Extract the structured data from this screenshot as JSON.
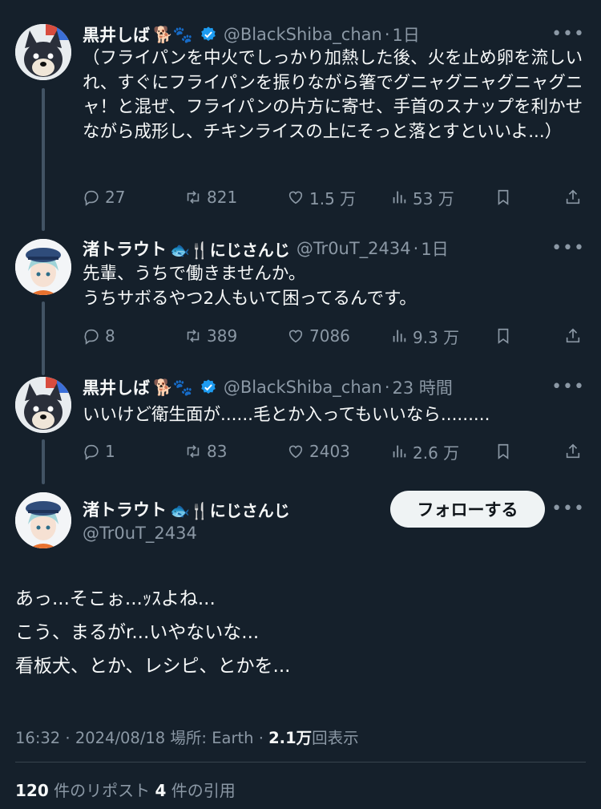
{
  "tweets": [
    {
      "name": "黒井しば",
      "emoji": "🐕🐾",
      "verified": true,
      "handle": "@BlackShiba_chan",
      "time": "1日",
      "text": "（フライパンを中火でしっかり加熱した後、火を止め卵を流しいれ、すぐにフライパンを振りながら箸でグニャグニャグニャグニャ！と混ぜ、フライパンの片方に寄せ、手首のスナップを利かせながら成形し、チキンライスの上にそっと落とすといいよ...）",
      "replies": "27",
      "retweets": "821",
      "likes": "1.5 万",
      "views": "53 万"
    },
    {
      "name": "渚トラウト",
      "emoji": "🐟🍴にじさんじ",
      "verified": false,
      "handle": "@Tr0uT_2434",
      "time": "1日",
      "text": "先輩、うちで働きませんか。\nうちサボるやつ2人もいて困ってるんです。",
      "replies": "8",
      "retweets": "389",
      "likes": "7086",
      "views": "9.3 万"
    },
    {
      "name": "黒井しば",
      "emoji": "🐕🐾",
      "verified": true,
      "handle": "@BlackShiba_chan",
      "time": "23 時間",
      "text": "いいけど衛生面が......毛とか入ってもいいなら.........",
      "replies": "1",
      "retweets": "83",
      "likes": "2403",
      "views": "2.6 万"
    }
  ],
  "main": {
    "name": "渚トラウト",
    "emoji": "🐟🍴にじさんじ",
    "handle": "@Tr0uT_2434",
    "follow_label": "フォローする",
    "text": "あっ...そこぉ...ｯｽよね...\nこう、まるがr...いやないな...\n看板犬、とか、レシピ、とかを...",
    "time": "16:32",
    "date": "2024/08/18",
    "location_label": "場所: Earth",
    "views_count": "2.1万",
    "views_label": "回表示",
    "reposts_count": "120",
    "reposts_label": "件のリポスト",
    "quotes_count": "4",
    "quotes_label": "件の引用"
  },
  "icons": {
    "reply": "reply-icon",
    "retweet": "retweet-icon",
    "like": "heart-icon",
    "views": "views-icon",
    "bookmark": "bookmark-icon",
    "share": "share-icon",
    "more": "more-icon",
    "verified": "verified-icon"
  },
  "colors": {
    "background": "#15202b",
    "text": "#f7f9f9",
    "secondary": "#8b98a5",
    "verified": "#1d9bf0",
    "follow_bg": "#eff3f4"
  }
}
